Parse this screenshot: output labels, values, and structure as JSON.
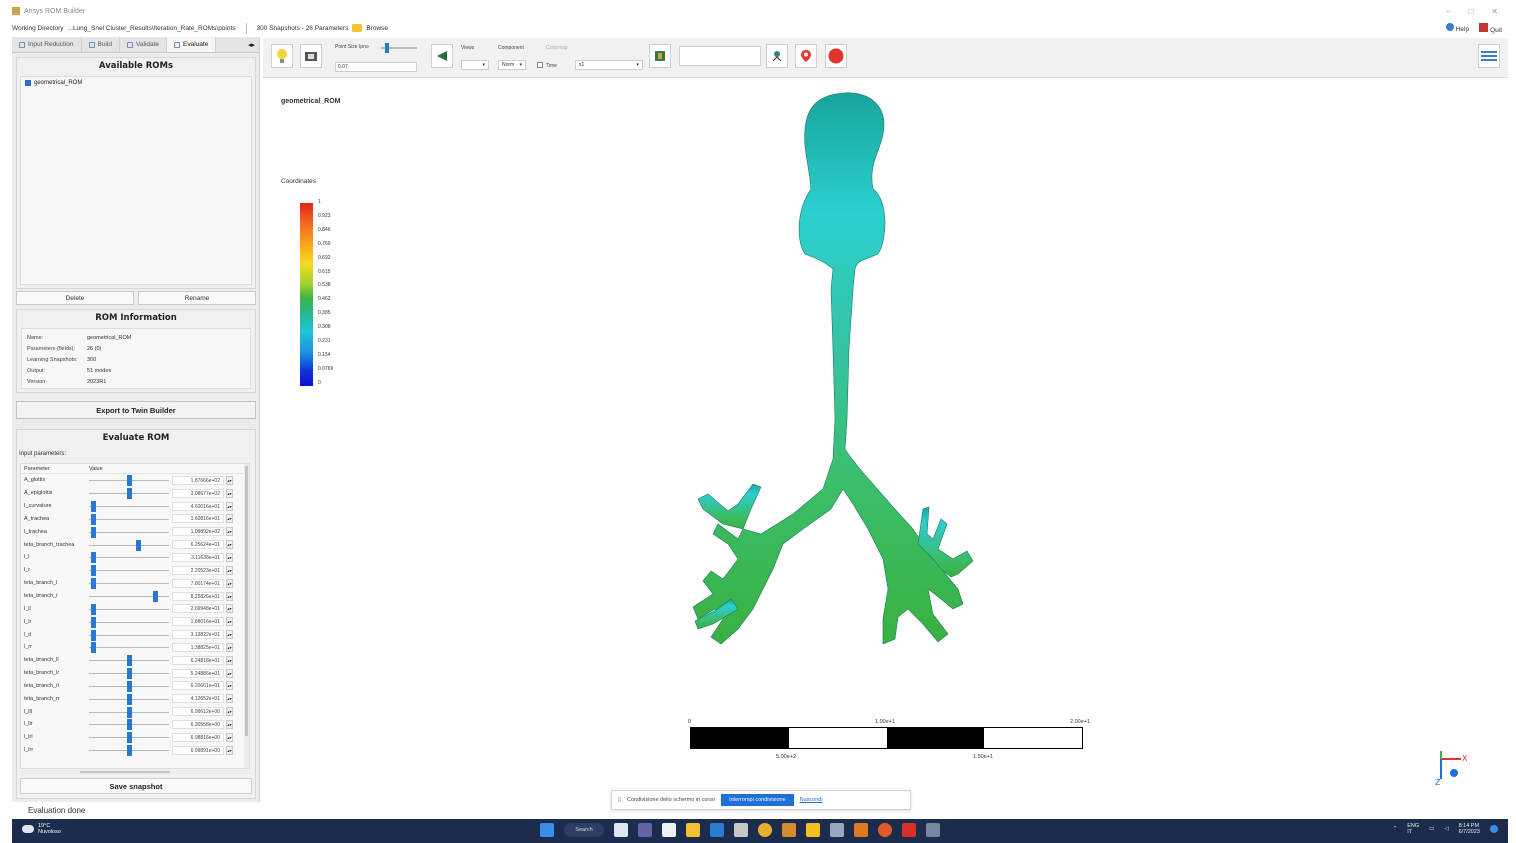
{
  "window": {
    "title": "Ansys ROM Builder"
  },
  "workdir": {
    "label": "Working Directory",
    "path": "...Lung_Snel Cluster_Results\\Iteration_Rate_ROMs\\points",
    "snapshots": "300 Snapshots - 26 Parameters",
    "browse": "Browse",
    "help": "Help",
    "quit": "Quit"
  },
  "tabs": [
    {
      "label": "Input Reduction"
    },
    {
      "label": "Build"
    },
    {
      "label": "Validate"
    },
    {
      "label": "Evaluate"
    }
  ],
  "roms": {
    "title": "Available ROMs",
    "items": [
      {
        "label": "geometrical_ROM",
        "checked": true
      }
    ],
    "delete_label": "Delete",
    "rename_label": "Rename"
  },
  "rominfo": {
    "title": "ROM Information",
    "rows": [
      {
        "key": "Name:",
        "value": "geometrical_ROM"
      },
      {
        "key": "Parameters (fields):",
        "value": "26 (0)"
      },
      {
        "key": "Learning Snapshots:",
        "value": "300"
      },
      {
        "key": "Output:",
        "value": "51 modes"
      },
      {
        "key": "Version:",
        "value": "2023R1"
      }
    ]
  },
  "export_label": "Export to Twin Builder",
  "evaluate": {
    "title": "Evaluate ROM",
    "input_label": "Input parameters:",
    "col_param": "Parameter",
    "col_value": "Value",
    "params": [
      {
        "name": "A_glottis",
        "value": "1.87666e+02",
        "pos": 0.5
      },
      {
        "name": "A_epiglottis",
        "value": "2.08677e+02",
        "pos": 0.5
      },
      {
        "name": "I_curvature",
        "value": "4.60016e+01",
        "pos": 0.03
      },
      {
        "name": "A_trachea",
        "value": "1.60816e+01",
        "pos": 0.03
      },
      {
        "name": "I_trachea",
        "value": "1.09892e+02",
        "pos": 0.03
      },
      {
        "name": "teta_branch_trachea",
        "value": "6.25624e+01",
        "pos": 0.62
      },
      {
        "name": "l_l",
        "value": "3.11638e+01",
        "pos": 0.03
      },
      {
        "name": "l_r",
        "value": "2.20523e+01",
        "pos": 0.03
      },
      {
        "name": "teta_branch_l",
        "value": "7.00174e+01",
        "pos": 0.03
      },
      {
        "name": "teta_branch_r",
        "value": "8.25826e+01",
        "pos": 0.85
      },
      {
        "name": "l_ll",
        "value": "2.69948e+01",
        "pos": 0.03
      },
      {
        "name": "l_lr",
        "value": "1.88016e+01",
        "pos": 0.03
      },
      {
        "name": "l_rl",
        "value": "3.13822e+01",
        "pos": 0.03
      },
      {
        "name": "l_rr",
        "value": "1.38825e+01",
        "pos": 0.03
      },
      {
        "name": "teta_branch_ll",
        "value": "6.24818e+01",
        "pos": 0.5
      },
      {
        "name": "teta_branch_lr",
        "value": "5.24886e+01",
        "pos": 0.5
      },
      {
        "name": "teta_branch_rl",
        "value": "6.20661e+01",
        "pos": 0.5
      },
      {
        "name": "teta_branch_rr",
        "value": "4.12652e+01",
        "pos": 0.5
      },
      {
        "name": "l_lll",
        "value": "6.99612e+00",
        "pos": 0.5
      },
      {
        "name": "l_llr",
        "value": "6.30558e+00",
        "pos": 0.5
      },
      {
        "name": "l_lrl",
        "value": "6.98816e+00",
        "pos": 0.5
      },
      {
        "name": "l_lrr",
        "value": "6.99891e+00",
        "pos": 0.5
      }
    ],
    "save_label": "Save snapshot"
  },
  "status_text": "Evaluation done",
  "toolbar": {
    "point_size_label": "Point Size Ipno",
    "point_size_value": "0.07",
    "views_label": "Views",
    "views_value": "",
    "component_label": "Component",
    "component_value": "Norm",
    "colormap_label": "Colormap",
    "time_label": "Time",
    "time_value": "x1"
  },
  "viewport": {
    "rom_name": "geometrical_ROM",
    "legend_title": "Coordinates",
    "legend_ticks": [
      "1",
      "0.923",
      "0.846",
      "0.769",
      "0.692",
      "0.615",
      "0.538",
      "0.462",
      "0.385",
      "0.308",
      "0.231",
      "0.154",
      "0.0769",
      "0"
    ],
    "scale_top": [
      "0",
      "1.00e+1",
      "2.00e+1"
    ],
    "scale_bottom": [
      "5.00e+2",
      "1.50e+1"
    ]
  },
  "toast": {
    "message": "Condivisione dello schermo in corso",
    "action": "Interrompi condivisione",
    "link": "Nascondi"
  },
  "taskbar": {
    "weather_temp": "19°C",
    "weather_desc": "Nuvoloso",
    "search": "Search",
    "lang": "ENG",
    "lang_sub": "IT",
    "time": "8:14 PM",
    "date": "6/7/2023"
  },
  "colors": {
    "accent": "#2a78d6",
    "mesh_top": "#1aa9a6",
    "mesh_mid": "#2fc8c0",
    "mesh_low": "#37b34a"
  }
}
